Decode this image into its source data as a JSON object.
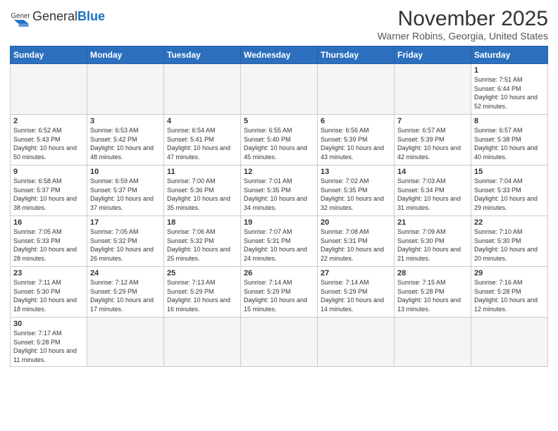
{
  "logo": {
    "text_general": "General",
    "text_blue": "Blue"
  },
  "header": {
    "title": "November 2025",
    "subtitle": "Warner Robins, Georgia, United States"
  },
  "weekdays": [
    "Sunday",
    "Monday",
    "Tuesday",
    "Wednesday",
    "Thursday",
    "Friday",
    "Saturday"
  ],
  "weeks": [
    [
      {
        "day": "",
        "info": ""
      },
      {
        "day": "",
        "info": ""
      },
      {
        "day": "",
        "info": ""
      },
      {
        "day": "",
        "info": ""
      },
      {
        "day": "",
        "info": ""
      },
      {
        "day": "",
        "info": ""
      },
      {
        "day": "1",
        "info": "Sunrise: 7:51 AM\nSunset: 6:44 PM\nDaylight: 10 hours and 52 minutes."
      }
    ],
    [
      {
        "day": "2",
        "info": "Sunrise: 6:52 AM\nSunset: 5:43 PM\nDaylight: 10 hours and 50 minutes."
      },
      {
        "day": "3",
        "info": "Sunrise: 6:53 AM\nSunset: 5:42 PM\nDaylight: 10 hours and 48 minutes."
      },
      {
        "day": "4",
        "info": "Sunrise: 6:54 AM\nSunset: 5:41 PM\nDaylight: 10 hours and 47 minutes."
      },
      {
        "day": "5",
        "info": "Sunrise: 6:55 AM\nSunset: 5:40 PM\nDaylight: 10 hours and 45 minutes."
      },
      {
        "day": "6",
        "info": "Sunrise: 6:56 AM\nSunset: 5:39 PM\nDaylight: 10 hours and 43 minutes."
      },
      {
        "day": "7",
        "info": "Sunrise: 6:57 AM\nSunset: 5:39 PM\nDaylight: 10 hours and 42 minutes."
      },
      {
        "day": "8",
        "info": "Sunrise: 6:57 AM\nSunset: 5:38 PM\nDaylight: 10 hours and 40 minutes."
      }
    ],
    [
      {
        "day": "9",
        "info": "Sunrise: 6:58 AM\nSunset: 5:37 PM\nDaylight: 10 hours and 38 minutes."
      },
      {
        "day": "10",
        "info": "Sunrise: 6:59 AM\nSunset: 5:37 PM\nDaylight: 10 hours and 37 minutes."
      },
      {
        "day": "11",
        "info": "Sunrise: 7:00 AM\nSunset: 5:36 PM\nDaylight: 10 hours and 35 minutes."
      },
      {
        "day": "12",
        "info": "Sunrise: 7:01 AM\nSunset: 5:35 PM\nDaylight: 10 hours and 34 minutes."
      },
      {
        "day": "13",
        "info": "Sunrise: 7:02 AM\nSunset: 5:35 PM\nDaylight: 10 hours and 32 minutes."
      },
      {
        "day": "14",
        "info": "Sunrise: 7:03 AM\nSunset: 5:34 PM\nDaylight: 10 hours and 31 minutes."
      },
      {
        "day": "15",
        "info": "Sunrise: 7:04 AM\nSunset: 5:33 PM\nDaylight: 10 hours and 29 minutes."
      }
    ],
    [
      {
        "day": "16",
        "info": "Sunrise: 7:05 AM\nSunset: 5:33 PM\nDaylight: 10 hours and 28 minutes."
      },
      {
        "day": "17",
        "info": "Sunrise: 7:05 AM\nSunset: 5:32 PM\nDaylight: 10 hours and 26 minutes."
      },
      {
        "day": "18",
        "info": "Sunrise: 7:06 AM\nSunset: 5:32 PM\nDaylight: 10 hours and 25 minutes."
      },
      {
        "day": "19",
        "info": "Sunrise: 7:07 AM\nSunset: 5:31 PM\nDaylight: 10 hours and 24 minutes."
      },
      {
        "day": "20",
        "info": "Sunrise: 7:08 AM\nSunset: 5:31 PM\nDaylight: 10 hours and 22 minutes."
      },
      {
        "day": "21",
        "info": "Sunrise: 7:09 AM\nSunset: 5:30 PM\nDaylight: 10 hours and 21 minutes."
      },
      {
        "day": "22",
        "info": "Sunrise: 7:10 AM\nSunset: 5:30 PM\nDaylight: 10 hours and 20 minutes."
      }
    ],
    [
      {
        "day": "23",
        "info": "Sunrise: 7:11 AM\nSunset: 5:30 PM\nDaylight: 10 hours and 18 minutes."
      },
      {
        "day": "24",
        "info": "Sunrise: 7:12 AM\nSunset: 5:29 PM\nDaylight: 10 hours and 17 minutes."
      },
      {
        "day": "25",
        "info": "Sunrise: 7:13 AM\nSunset: 5:29 PM\nDaylight: 10 hours and 16 minutes."
      },
      {
        "day": "26",
        "info": "Sunrise: 7:14 AM\nSunset: 5:29 PM\nDaylight: 10 hours and 15 minutes."
      },
      {
        "day": "27",
        "info": "Sunrise: 7:14 AM\nSunset: 5:29 PM\nDaylight: 10 hours and 14 minutes."
      },
      {
        "day": "28",
        "info": "Sunrise: 7:15 AM\nSunset: 5:28 PM\nDaylight: 10 hours and 13 minutes."
      },
      {
        "day": "29",
        "info": "Sunrise: 7:16 AM\nSunset: 5:28 PM\nDaylight: 10 hours and 12 minutes."
      }
    ],
    [
      {
        "day": "30",
        "info": "Sunrise: 7:17 AM\nSunset: 5:28 PM\nDaylight: 10 hours and 11 minutes."
      },
      {
        "day": "",
        "info": ""
      },
      {
        "day": "",
        "info": ""
      },
      {
        "day": "",
        "info": ""
      },
      {
        "day": "",
        "info": ""
      },
      {
        "day": "",
        "info": ""
      },
      {
        "day": "",
        "info": ""
      }
    ]
  ]
}
